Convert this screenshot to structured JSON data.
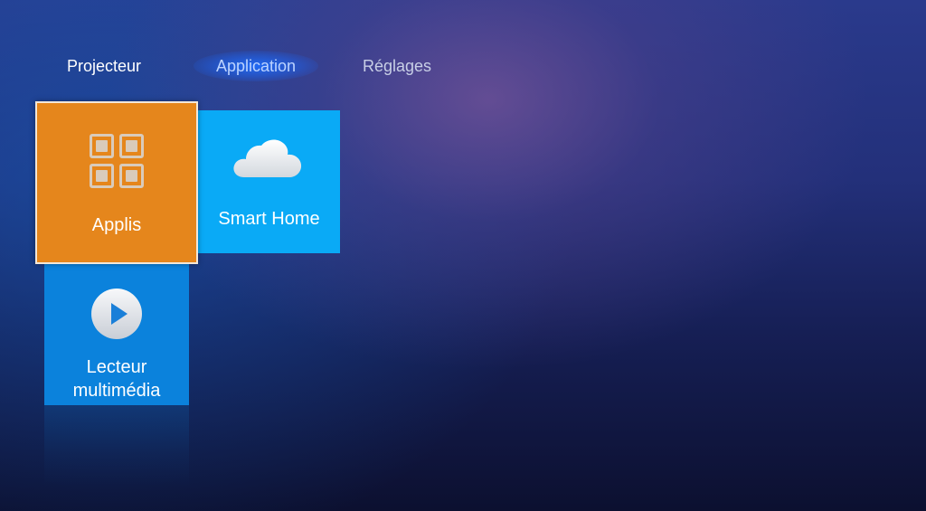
{
  "nav": {
    "tabs": [
      {
        "label": "Projecteur",
        "active": false
      },
      {
        "label": "Application",
        "active": true
      },
      {
        "label": "Réglages",
        "active": false
      }
    ]
  },
  "tiles": [
    {
      "label": "Applis",
      "icon": "apps-grid-icon",
      "color": "#e5861c",
      "focused": true
    },
    {
      "label": "Smart Home",
      "icon": "cloud-icon",
      "color": "#0aaaf6",
      "focused": false
    },
    {
      "label_line1": "Lecteur",
      "label_line2": "multimédia",
      "icon": "play-icon",
      "color": "#0b82dc",
      "focused": false
    }
  ]
}
